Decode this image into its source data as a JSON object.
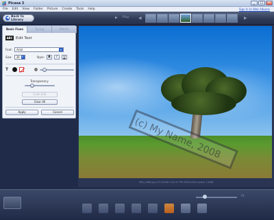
{
  "window": {
    "title": "Picasa 3",
    "controls": [
      "_",
      "□",
      "✕"
    ]
  },
  "menu": {
    "items": [
      "File",
      "Edit",
      "View",
      "Folder",
      "Picture",
      "Create",
      "Tools",
      "Help"
    ],
    "sign_in": "Sign In to Web Albums"
  },
  "toolbar": {
    "back_label": "Back to Library",
    "play_label": "Play"
  },
  "panel": {
    "tabs": [
      {
        "label": "Basic Fixes",
        "active": true
      },
      {
        "label": "Tuning",
        "active": false
      },
      {
        "label": "Effects",
        "active": false
      }
    ],
    "tool_badge": "ABC",
    "heading": "Edit Text",
    "font_label": "Font:",
    "font_value": "Arial",
    "size_label": "Size:",
    "size_value": "36",
    "style_label": "Style:",
    "bold": "B",
    "italic": "I",
    "underline": "U",
    "text_color_label": "T",
    "transparency_label": "Transparency",
    "text_color": "#111111",
    "outline_color": "#ffffff",
    "text_opacity": 0.5,
    "transparency": 0.2,
    "clear_label": "Clear All",
    "disabled_label": "Undo Edit",
    "apply_label": "Apply",
    "cancel_label": "Cancel"
  },
  "photo": {
    "watermark": "(c) My Name, 2008",
    "status": "IMG_0480.jpg    2/27/2008 1:42:31 PM    2592x1944 pixels    1.4MB"
  },
  "bottom": {
    "zoom_label": "Fit"
  }
}
